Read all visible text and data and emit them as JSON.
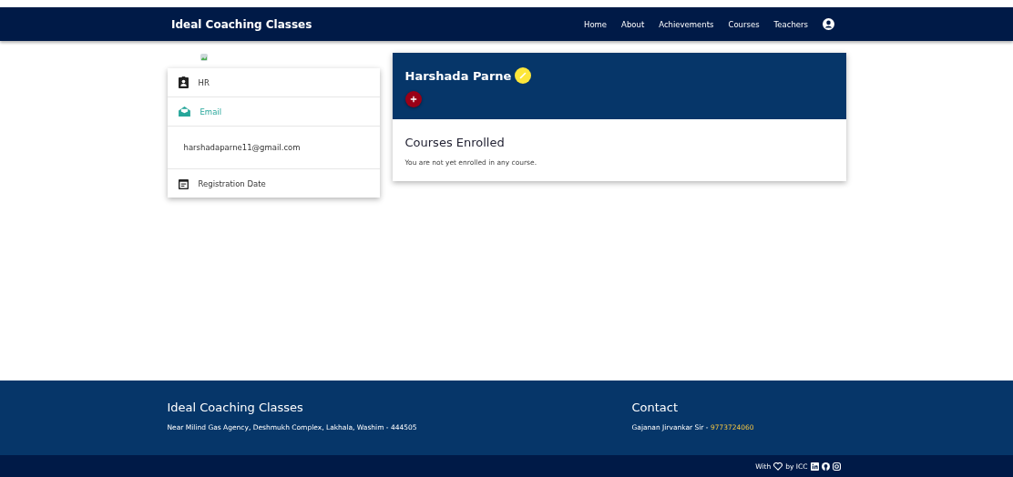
{
  "navbar": {
    "brand": "Ideal Coaching Classes",
    "links": [
      "Home",
      "About",
      "Achievements",
      "Courses",
      "Teachers"
    ]
  },
  "profile_card": {
    "items": [
      {
        "kind": "role",
        "label": "HR"
      },
      {
        "kind": "email-heading",
        "label": "Email"
      },
      {
        "kind": "value",
        "label": "harshadaparne11@gmail.com"
      },
      {
        "kind": "date",
        "label": "Registration Date"
      }
    ]
  },
  "header": {
    "name": "Harshada Parne"
  },
  "courses": {
    "title": "Courses Enrolled",
    "message": "You are not yet enrolled in any course."
  },
  "footer": {
    "title": "Ideal Coaching Classes",
    "address": "Near Milind Gas Agency, Deshmukh Complex, Lakhala, Washim - 444505",
    "contact_title": "Contact",
    "contact_name": "Gajanan Jirvankar Sir - ",
    "phone": "9773724060"
  },
  "bottom_bar": {
    "with": "With",
    "by": "by ICC"
  }
}
